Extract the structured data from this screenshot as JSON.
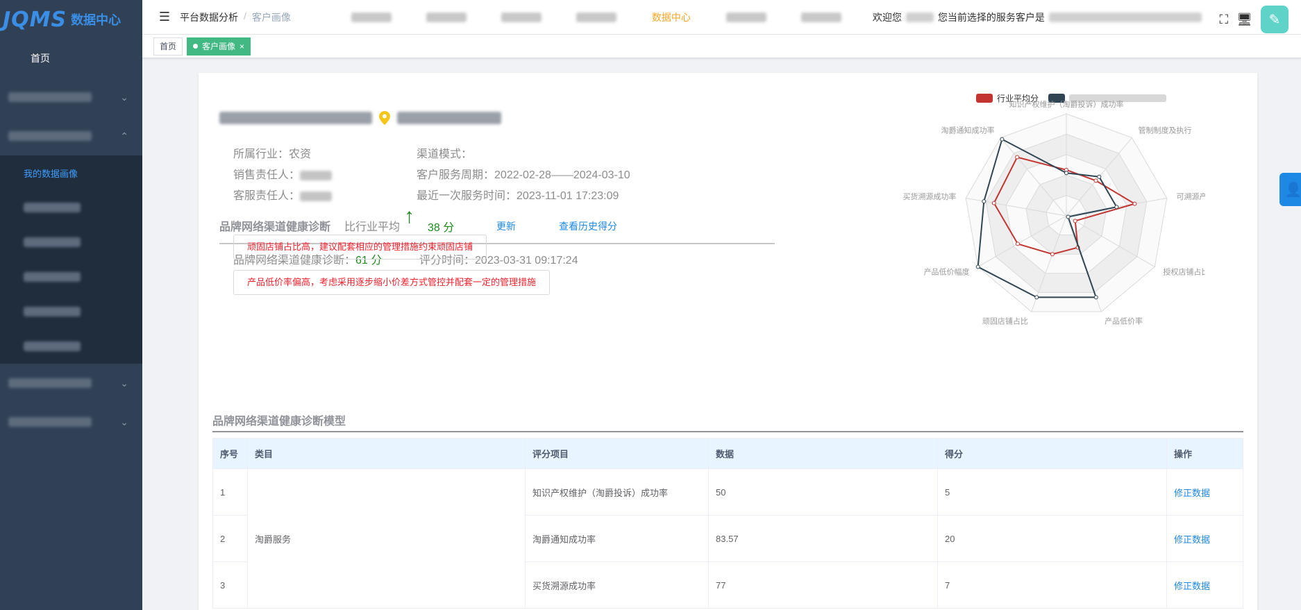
{
  "brand": {
    "logo": "JQMS",
    "subtitle": "数据中心"
  },
  "sidebar": {
    "home": "首页",
    "submenu_active": "我的数据画像"
  },
  "header": {
    "breadcrumb": [
      "平台数据分析",
      "客户画像"
    ],
    "topnav_active": "数据中心",
    "welcome": "欢迎您",
    "current_customer": "您当前选择的服务客户是"
  },
  "tags": {
    "home": "首页",
    "active": "客户画像",
    "close": "×"
  },
  "profile": {
    "industry_label": "所属行业：",
    "industry": "农资",
    "channel_label": "渠道模式：",
    "sales_label": "销售责任人：",
    "service_period_label": "客户服务周期：",
    "service_period": "2022-02-28——2024-03-10",
    "cs_label": "客服责任人：",
    "last_service_label": "最近一次服务时间：",
    "last_service": "2023-11-01 17:23:09"
  },
  "diagnosis": {
    "title": "品牌网络渠道健康诊断",
    "compare_label": "比行业平均",
    "compare_value": "38 分",
    "update": "更新",
    "history": "查看历史得分",
    "score_label": "品牌网络渠道健康诊断：",
    "score": "61 分",
    "eval_time_label": "评分时间：",
    "eval_time": "2023-03-31 09:17:24",
    "warnings": [
      "顽固店铺占比高，建议配套相应的管理措施约束顽固店铺",
      "产品低价率偏高，考虑采用逐步缩小价差方式管控并配套一定的管理措施"
    ]
  },
  "chart_data": {
    "type": "radar",
    "legend": [
      "行业平均分"
    ],
    "indicators": [
      "知识产权维护（淘爵投诉）成功率",
      "管制制度及执行",
      "可溯源产品占比",
      "授权店铺占比",
      "产品低价率",
      "顽固店铺占比",
      "产品低价幅度",
      "买货溯源成功率",
      "淘爵通知成功率"
    ],
    "series": [
      {
        "name": "行业平均分",
        "color": "#c23531",
        "values": [
          0.45,
          0.45,
          0.68,
          0.1,
          0.33,
          0.4,
          0.55,
          0.72,
          0.75
        ]
      },
      {
        "color": "#2f4554",
        "values": [
          0.42,
          0.5,
          0.5,
          0.02,
          0.85,
          0.85,
          1.0,
          0.82,
          0.98
        ]
      }
    ]
  },
  "model": {
    "title": "品牌网络渠道健康诊断模型",
    "headers": [
      "序号",
      "类目",
      "评分项目",
      "数据",
      "得分",
      "操作"
    ],
    "category": "淘爵服务",
    "rows": [
      {
        "no": "1",
        "item": "知识产权维护（淘爵投诉）成功率",
        "data": "50",
        "score": "5",
        "op": "修正数据"
      },
      {
        "no": "2",
        "item": "淘爵通知成功率",
        "data": "83.57",
        "score": "20",
        "op": "修正数据"
      },
      {
        "no": "3",
        "item": "买货溯源成功率",
        "data": "77",
        "score": "7",
        "op": "修正数据"
      }
    ]
  }
}
